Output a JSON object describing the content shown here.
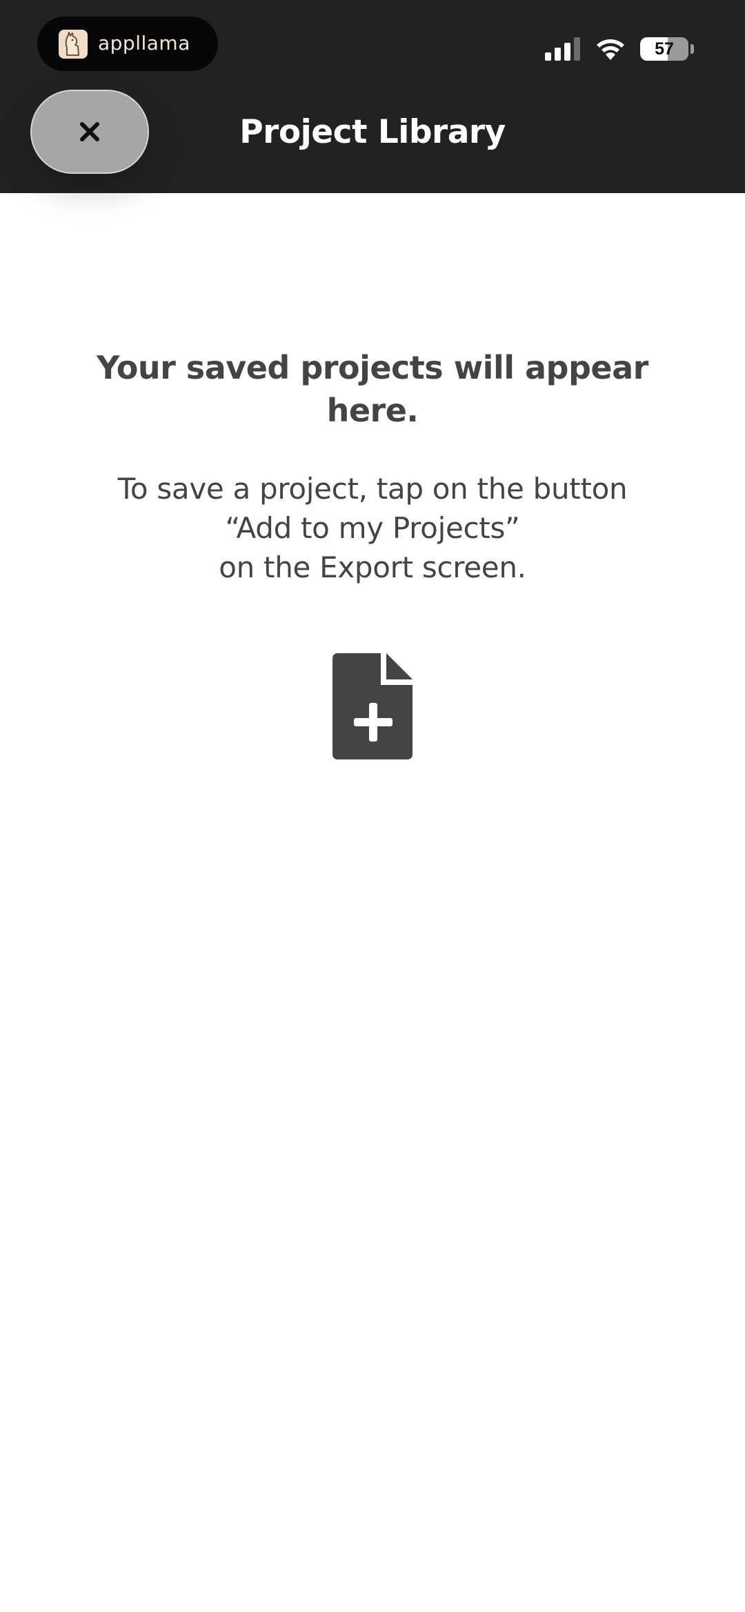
{
  "status_bar": {
    "brand_name": "appllama",
    "battery_percent": 57,
    "battery_label": "57",
    "icons": [
      "cellular-signal-icon",
      "wifi-icon",
      "battery-icon"
    ]
  },
  "header": {
    "title": "Project Library",
    "close_icon": "close-icon",
    "background_color": "#222222"
  },
  "empty_state": {
    "heading": "Your saved projects will appear here.",
    "instructions": [
      "To save a project, tap on the button",
      "“Add to my Projects”",
      "on the Export screen."
    ],
    "icon": "file-plus-icon",
    "text_color": "#444444"
  }
}
